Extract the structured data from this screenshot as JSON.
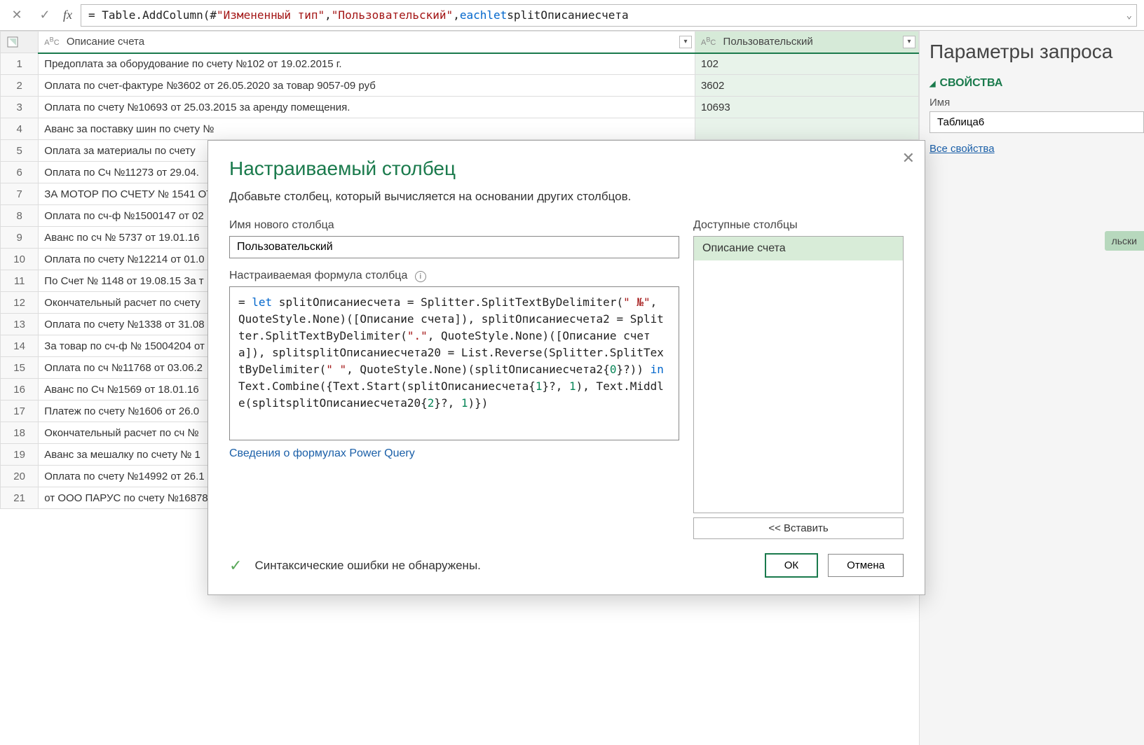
{
  "formula_bar": {
    "prefix": "= Table.AddColumn(#",
    "arg1": "\"Измененный тип\"",
    "sep1": ", ",
    "arg2": "\"Пользовательский\"",
    "sep2": ", ",
    "kw_each": "each",
    "kw_let": "let",
    "tail": " splitОписаниесчета"
  },
  "columns": [
    {
      "name": "Описание счета",
      "type": "ABC"
    },
    {
      "name": "Пользовательский",
      "type": "ABC"
    }
  ],
  "rows": [
    {
      "n": 1,
      "c0": "Предоплата за оборудование  по счету №102 от 19.02.2015 г.",
      "c1": "102"
    },
    {
      "n": 2,
      "c0": "Оплата по счет-фактуре №3602 от 26.05.2020 за товар 9057-09 руб",
      "c1": "3602"
    },
    {
      "n": 3,
      "c0": "Оплата по счету №10693 от 25.03.2015 за аренду помещения.",
      "c1": "10693"
    },
    {
      "n": 4,
      "c0": "Аванс за поставку шин по счету №",
      "c1": ""
    },
    {
      "n": 5,
      "c0": "Оплата за материалы  по счету",
      "c1": ""
    },
    {
      "n": 6,
      "c0": "Оплата по Сч №11273 от 29.04.",
      "c1": ""
    },
    {
      "n": 7,
      "c0": "ЗА МОТОР ПО СЧЕТУ № 1541 ОТ",
      "c1": ""
    },
    {
      "n": 8,
      "c0": "Оплата по сч-ф №1500147 от 02",
      "c1": ""
    },
    {
      "n": 9,
      "c0": "Аванс  по сч № 5737 от 19.01.16",
      "c1": ""
    },
    {
      "n": 10,
      "c0": "Оплата по счету №12214 от 01.0",
      "c1": ""
    },
    {
      "n": 11,
      "c0": "По Счет № 1148 от 19.08.15 За т",
      "c1": ""
    },
    {
      "n": 12,
      "c0": "Окончательный расчет по счету",
      "c1": ""
    },
    {
      "n": 13,
      "c0": "Оплата по счету №1338 от 31.08",
      "c1": ""
    },
    {
      "n": 14,
      "c0": "За товар по сч-ф № 15004204 от",
      "c1": ""
    },
    {
      "n": 15,
      "c0": "Оплата по сч №11768 от 03.06.2",
      "c1": ""
    },
    {
      "n": 16,
      "c0": "Аванс  по Сч №1569 от 18.01.16",
      "c1": ""
    },
    {
      "n": 17,
      "c0": "Платеж по счету №1606 от 26.0",
      "c1": ""
    },
    {
      "n": 18,
      "c0": "Окончательный расчет по сч №",
      "c1": ""
    },
    {
      "n": 19,
      "c0": "Аванс за мешалку по счету № 1",
      "c1": ""
    },
    {
      "n": 20,
      "c0": "Оплата по счету №14992 от 26.1",
      "c1": ""
    },
    {
      "n": 21,
      "c0": "от ООО ПАРУС по счету №16878",
      "c1": ""
    }
  ],
  "right": {
    "title": "Параметры запроса",
    "props": "СВОЙСТВА",
    "name_label": "Имя",
    "name_value": "Таблица6",
    "all_props": "Все свойства",
    "badge": "льски"
  },
  "dialog": {
    "title": "Настраиваемый столбец",
    "subtitle": "Добавьте столбец, который вычисляется на основании других столбцов.",
    "new_col_label": "Имя нового столбца",
    "new_col_value": "Пользовательский",
    "formula_label": "Настраиваемая формула столбца",
    "avail_label": "Доступные столбцы",
    "avail_item": "Описание счета",
    "insert": "<< Вставить",
    "help_link": "Сведения о формулах Power Query",
    "status": "Синтаксические ошибки не обнаружены.",
    "ok": "ОК",
    "cancel": "Отмена",
    "formula_tokens": [
      {
        "t": "= ",
        "c": "plain"
      },
      {
        "t": "let",
        "c": "kw"
      },
      {
        "t": " splitОписаниесчета = Splitter.SplitTextByDelimiter(",
        "c": "plain"
      },
      {
        "t": "\" №\"",
        "c": "str"
      },
      {
        "t": ", QuoteStyle.None)([Описание счета]), splitОписаниесчета2 = Splitter.SplitTextByDelimiter(",
        "c": "plain"
      },
      {
        "t": "\".\"",
        "c": "str"
      },
      {
        "t": ", QuoteStyle.None)([Описание счета]), splitsplitОписаниесчета20 = List.Reverse(Splitter.SplitTextByDelimiter(",
        "c": "plain"
      },
      {
        "t": "\" \"",
        "c": "str"
      },
      {
        "t": ", QuoteStyle.None)(splitОписаниесчета2{",
        "c": "plain"
      },
      {
        "t": "0",
        "c": "num"
      },
      {
        "t": "}?)) ",
        "c": "plain"
      },
      {
        "t": "in",
        "c": "kw"
      },
      {
        "t": " Text.Combine({Text.Start(splitОписаниесчета{",
        "c": "plain"
      },
      {
        "t": "1",
        "c": "num"
      },
      {
        "t": "}?, ",
        "c": "plain"
      },
      {
        "t": "1",
        "c": "num"
      },
      {
        "t": "), Text.Middle(splitsplitОписаниесчета20{",
        "c": "plain"
      },
      {
        "t": "2",
        "c": "num"
      },
      {
        "t": "}?, ",
        "c": "plain"
      },
      {
        "t": "1",
        "c": "num"
      },
      {
        "t": ")})",
        "c": "plain"
      }
    ]
  }
}
